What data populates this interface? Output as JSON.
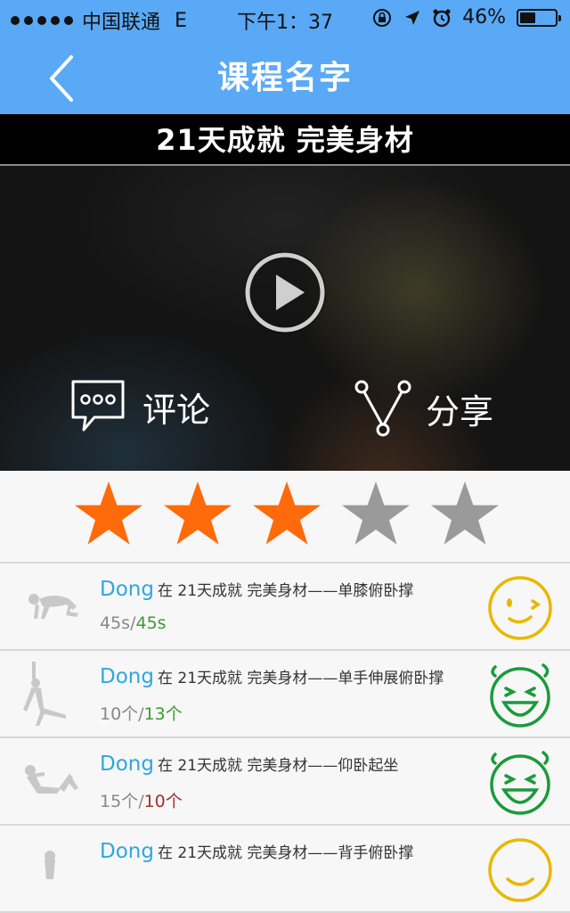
{
  "status": {
    "carrier": "中国联通",
    "network": "E",
    "time": "下午1：37",
    "battery": "46%",
    "battery_level": 0.46
  },
  "nav": {
    "title": "课程名字",
    "back_icon": "chevron-left-icon"
  },
  "hero": {
    "banner": "21天成就 完美身材",
    "play_icon": "play-icon",
    "comment_label": "评论",
    "share_label": "分享"
  },
  "rating": {
    "value": 3,
    "max": 5,
    "filled_color": "#ff6a0a",
    "empty_color": "#9a9a9a"
  },
  "feed": [
    {
      "user": "Dong",
      "text": "在 21天成就 完美身材——单膝俯卧撑",
      "target": "45s",
      "done": "45s",
      "done_color": "#3d9b35",
      "face": "wink",
      "face_color": "#e8b800"
    },
    {
      "user": "Dong",
      "text": "在 21天成就 完美身材——单手伸展俯卧撑",
      "target": "10个",
      "done": "13个",
      "done_color": "#3d9b35",
      "face": "laugh",
      "face_color": "#1a9b3a"
    },
    {
      "user": "Dong",
      "text": "在 21天成就 完美身材——仰卧起坐",
      "target": "15个",
      "done": "10个",
      "done_color": "#a0302a",
      "face": "laugh",
      "face_color": "#1a9b3a"
    },
    {
      "user": "Dong",
      "text": "在 21天成就 完美身材——背手俯卧撑",
      "target": "",
      "done": "",
      "done_color": "#3d9b35",
      "face": "smile",
      "face_color": "#e8b800"
    }
  ]
}
